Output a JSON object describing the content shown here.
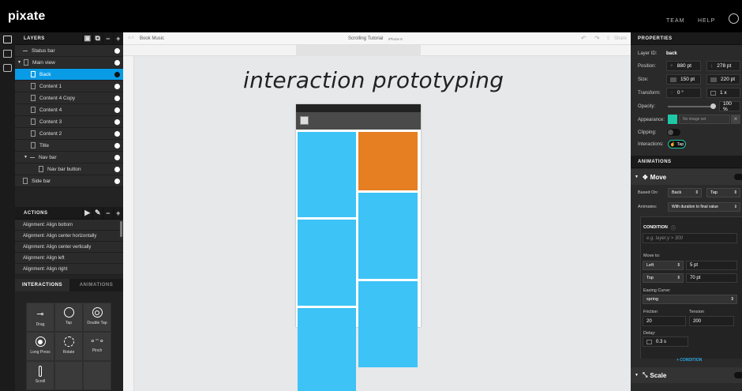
{
  "app": {
    "logo": "pixate"
  },
  "topnav": {
    "team": "TEAM",
    "help": "HELP"
  },
  "layers_panel": {
    "title": "LAYERS",
    "rows": [
      {
        "label": "Status bar"
      },
      {
        "label": "Main view"
      },
      {
        "label": "Back"
      },
      {
        "label": "Content 1"
      },
      {
        "label": "Content 4 Copy"
      },
      {
        "label": "Content 4"
      },
      {
        "label": "Content 3"
      },
      {
        "label": "Content 2"
      },
      {
        "label": "Title"
      },
      {
        "label": "Nav bar"
      },
      {
        "label": "Nav bar button"
      },
      {
        "label": "Side bar"
      }
    ]
  },
  "actions_panel": {
    "title": "ACTIONS",
    "items": [
      "Alignment: Align bottom",
      "Alignment: Align center horizontally",
      "Alignment: Align center vertically",
      "Alignment: Align left",
      "Alignment: Align right"
    ]
  },
  "bottom_tabs": {
    "interactions": "INTERACTIONS",
    "animations": "ANIMATIONS"
  },
  "gestures": [
    "Drag",
    "Tap",
    "Double Tap",
    "Long Press",
    "Rotate",
    "Pinch",
    "Scroll"
  ],
  "canvas": {
    "breadcrumb": "Book Music",
    "doc_title": "Scrolling Tutorial",
    "device": "iPhone 6",
    "share": "Share",
    "overlay_text": "interaction prototyping"
  },
  "properties": {
    "title": "PROPERTIES",
    "layer_id_label": "Layer ID:",
    "layer_id": "back",
    "position_label": "Position:",
    "pos_x": "880 pt",
    "pos_y": "278 pt",
    "size_label": "Size:",
    "width": "150 pt",
    "height": "220 pt",
    "transform_label": "Transform:",
    "rotation": "0 °",
    "scale": "1 x",
    "opacity_label": "Opacity:",
    "opacity": "100 %",
    "appearance_label": "Appearance:",
    "image": "No image set",
    "clipping_label": "Clipping:",
    "interactions_label": "Interactions:",
    "interaction_tag": "Tap",
    "accent": "#1fc7a6"
  },
  "animations": {
    "title": "ANIMATIONS",
    "move_title": "Move",
    "based_on_label": "Based On:",
    "based_on": "Back",
    "based_on_event": "Tap",
    "animates_label": "Animates:",
    "animates": "With duration to final value",
    "condition_label": "CONDITION",
    "condition_placeholder": "e.g. layer.y > 300",
    "move_to_label": "Move to:",
    "left_label": "Left",
    "left_value": "5 pt",
    "top_label": "Top",
    "top_value": "70 pt",
    "easing_label": "Easing Curve:",
    "easing": "spring",
    "friction_label": "Friction",
    "friction": "20",
    "tension_label": "Tension",
    "tension": "200",
    "delay_label": "Delay:",
    "delay": "0.3 s",
    "add_condition": "+ CONDITION",
    "scale_title": "Scale"
  }
}
